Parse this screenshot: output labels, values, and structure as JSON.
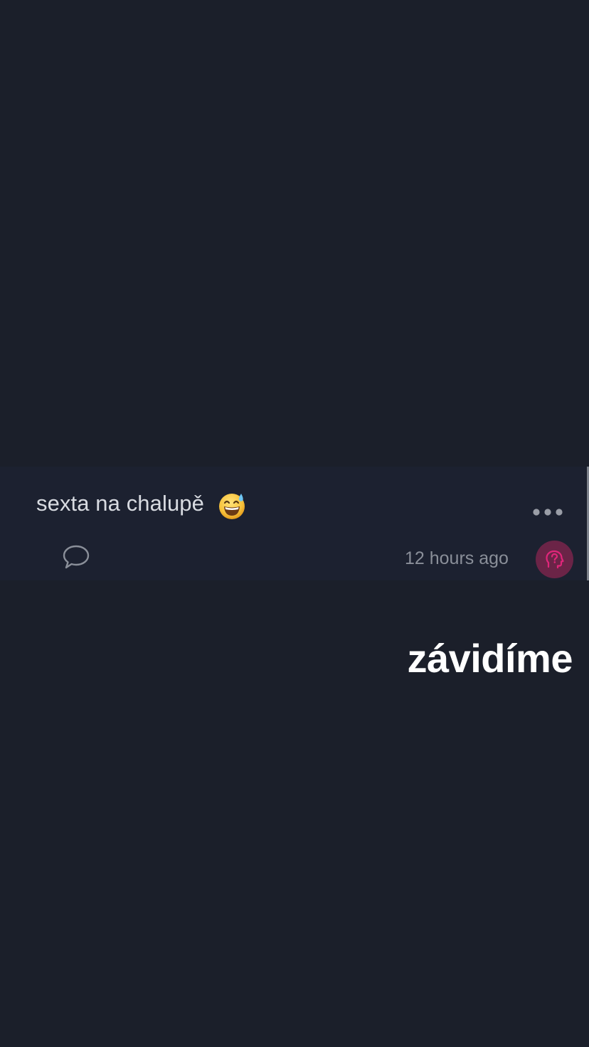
{
  "post": {
    "text": "sexta na chalupě",
    "emoji_icon": "grinning-face-with-sweat-emoji",
    "more_icon": "ellipsis-icon",
    "comment_icon": "speech-bubble-icon",
    "timestamp": "12 hours ago",
    "avatar_icon": "head-question-mark-icon",
    "avatar_color": "#6b2447",
    "avatar_accent": "#e0267a"
  },
  "overlay": {
    "caption": "závidíme"
  },
  "colors": {
    "background": "#1b1f2a",
    "card": "#1c2130",
    "text": "#d8dbe1",
    "muted": "#8a8f99",
    "caption": "#ffffff"
  }
}
